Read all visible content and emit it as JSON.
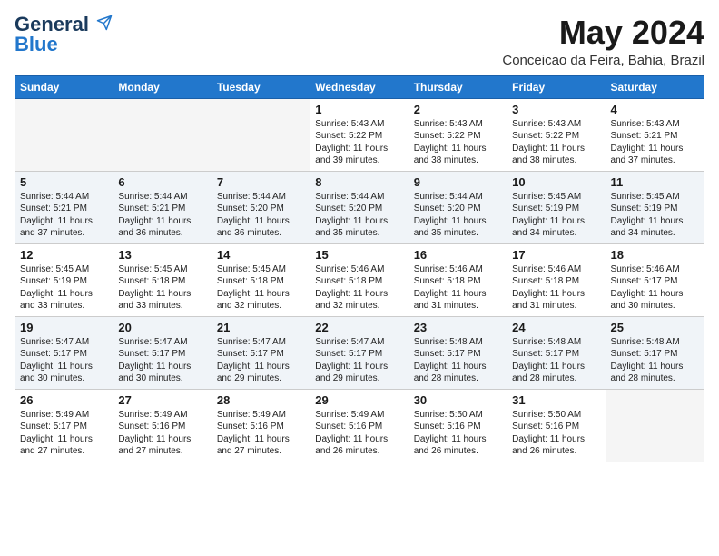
{
  "logo": {
    "general": "General",
    "blue": "Blue"
  },
  "title": "May 2024",
  "location": "Conceicao da Feira, Bahia, Brazil",
  "days_of_week": [
    "Sunday",
    "Monday",
    "Tuesday",
    "Wednesday",
    "Thursday",
    "Friday",
    "Saturday"
  ],
  "weeks": [
    [
      {
        "day": "",
        "sunrise": "",
        "sunset": "",
        "daylight": "",
        "empty": true
      },
      {
        "day": "",
        "sunrise": "",
        "sunset": "",
        "daylight": "",
        "empty": true
      },
      {
        "day": "",
        "sunrise": "",
        "sunset": "",
        "daylight": "",
        "empty": true
      },
      {
        "day": "1",
        "sunrise": "Sunrise: 5:43 AM",
        "sunset": "Sunset: 5:22 PM",
        "daylight": "Daylight: 11 hours and 39 minutes."
      },
      {
        "day": "2",
        "sunrise": "Sunrise: 5:43 AM",
        "sunset": "Sunset: 5:22 PM",
        "daylight": "Daylight: 11 hours and 38 minutes."
      },
      {
        "day": "3",
        "sunrise": "Sunrise: 5:43 AM",
        "sunset": "Sunset: 5:22 PM",
        "daylight": "Daylight: 11 hours and 38 minutes."
      },
      {
        "day": "4",
        "sunrise": "Sunrise: 5:43 AM",
        "sunset": "Sunset: 5:21 PM",
        "daylight": "Daylight: 11 hours and 37 minutes."
      }
    ],
    [
      {
        "day": "5",
        "sunrise": "Sunrise: 5:44 AM",
        "sunset": "Sunset: 5:21 PM",
        "daylight": "Daylight: 11 hours and 37 minutes."
      },
      {
        "day": "6",
        "sunrise": "Sunrise: 5:44 AM",
        "sunset": "Sunset: 5:21 PM",
        "daylight": "Daylight: 11 hours and 36 minutes."
      },
      {
        "day": "7",
        "sunrise": "Sunrise: 5:44 AM",
        "sunset": "Sunset: 5:20 PM",
        "daylight": "Daylight: 11 hours and 36 minutes."
      },
      {
        "day": "8",
        "sunrise": "Sunrise: 5:44 AM",
        "sunset": "Sunset: 5:20 PM",
        "daylight": "Daylight: 11 hours and 35 minutes."
      },
      {
        "day": "9",
        "sunrise": "Sunrise: 5:44 AM",
        "sunset": "Sunset: 5:20 PM",
        "daylight": "Daylight: 11 hours and 35 minutes."
      },
      {
        "day": "10",
        "sunrise": "Sunrise: 5:45 AM",
        "sunset": "Sunset: 5:19 PM",
        "daylight": "Daylight: 11 hours and 34 minutes."
      },
      {
        "day": "11",
        "sunrise": "Sunrise: 5:45 AM",
        "sunset": "Sunset: 5:19 PM",
        "daylight": "Daylight: 11 hours and 34 minutes."
      }
    ],
    [
      {
        "day": "12",
        "sunrise": "Sunrise: 5:45 AM",
        "sunset": "Sunset: 5:19 PM",
        "daylight": "Daylight: 11 hours and 33 minutes."
      },
      {
        "day": "13",
        "sunrise": "Sunrise: 5:45 AM",
        "sunset": "Sunset: 5:18 PM",
        "daylight": "Daylight: 11 hours and 33 minutes."
      },
      {
        "day": "14",
        "sunrise": "Sunrise: 5:45 AM",
        "sunset": "Sunset: 5:18 PM",
        "daylight": "Daylight: 11 hours and 32 minutes."
      },
      {
        "day": "15",
        "sunrise": "Sunrise: 5:46 AM",
        "sunset": "Sunset: 5:18 PM",
        "daylight": "Daylight: 11 hours and 32 minutes."
      },
      {
        "day": "16",
        "sunrise": "Sunrise: 5:46 AM",
        "sunset": "Sunset: 5:18 PM",
        "daylight": "Daylight: 11 hours and 31 minutes."
      },
      {
        "day": "17",
        "sunrise": "Sunrise: 5:46 AM",
        "sunset": "Sunset: 5:18 PM",
        "daylight": "Daylight: 11 hours and 31 minutes."
      },
      {
        "day": "18",
        "sunrise": "Sunrise: 5:46 AM",
        "sunset": "Sunset: 5:17 PM",
        "daylight": "Daylight: 11 hours and 30 minutes."
      }
    ],
    [
      {
        "day": "19",
        "sunrise": "Sunrise: 5:47 AM",
        "sunset": "Sunset: 5:17 PM",
        "daylight": "Daylight: 11 hours and 30 minutes."
      },
      {
        "day": "20",
        "sunrise": "Sunrise: 5:47 AM",
        "sunset": "Sunset: 5:17 PM",
        "daylight": "Daylight: 11 hours and 30 minutes."
      },
      {
        "day": "21",
        "sunrise": "Sunrise: 5:47 AM",
        "sunset": "Sunset: 5:17 PM",
        "daylight": "Daylight: 11 hours and 29 minutes."
      },
      {
        "day": "22",
        "sunrise": "Sunrise: 5:47 AM",
        "sunset": "Sunset: 5:17 PM",
        "daylight": "Daylight: 11 hours and 29 minutes."
      },
      {
        "day": "23",
        "sunrise": "Sunrise: 5:48 AM",
        "sunset": "Sunset: 5:17 PM",
        "daylight": "Daylight: 11 hours and 28 minutes."
      },
      {
        "day": "24",
        "sunrise": "Sunrise: 5:48 AM",
        "sunset": "Sunset: 5:17 PM",
        "daylight": "Daylight: 11 hours and 28 minutes."
      },
      {
        "day": "25",
        "sunrise": "Sunrise: 5:48 AM",
        "sunset": "Sunset: 5:17 PM",
        "daylight": "Daylight: 11 hours and 28 minutes."
      }
    ],
    [
      {
        "day": "26",
        "sunrise": "Sunrise: 5:49 AM",
        "sunset": "Sunset: 5:17 PM",
        "daylight": "Daylight: 11 hours and 27 minutes."
      },
      {
        "day": "27",
        "sunrise": "Sunrise: 5:49 AM",
        "sunset": "Sunset: 5:16 PM",
        "daylight": "Daylight: 11 hours and 27 minutes."
      },
      {
        "day": "28",
        "sunrise": "Sunrise: 5:49 AM",
        "sunset": "Sunset: 5:16 PM",
        "daylight": "Daylight: 11 hours and 27 minutes."
      },
      {
        "day": "29",
        "sunrise": "Sunrise: 5:49 AM",
        "sunset": "Sunset: 5:16 PM",
        "daylight": "Daylight: 11 hours and 26 minutes."
      },
      {
        "day": "30",
        "sunrise": "Sunrise: 5:50 AM",
        "sunset": "Sunset: 5:16 PM",
        "daylight": "Daylight: 11 hours and 26 minutes."
      },
      {
        "day": "31",
        "sunrise": "Sunrise: 5:50 AM",
        "sunset": "Sunset: 5:16 PM",
        "daylight": "Daylight: 11 hours and 26 minutes."
      },
      {
        "day": "",
        "sunrise": "",
        "sunset": "",
        "daylight": "",
        "empty": true
      }
    ]
  ]
}
